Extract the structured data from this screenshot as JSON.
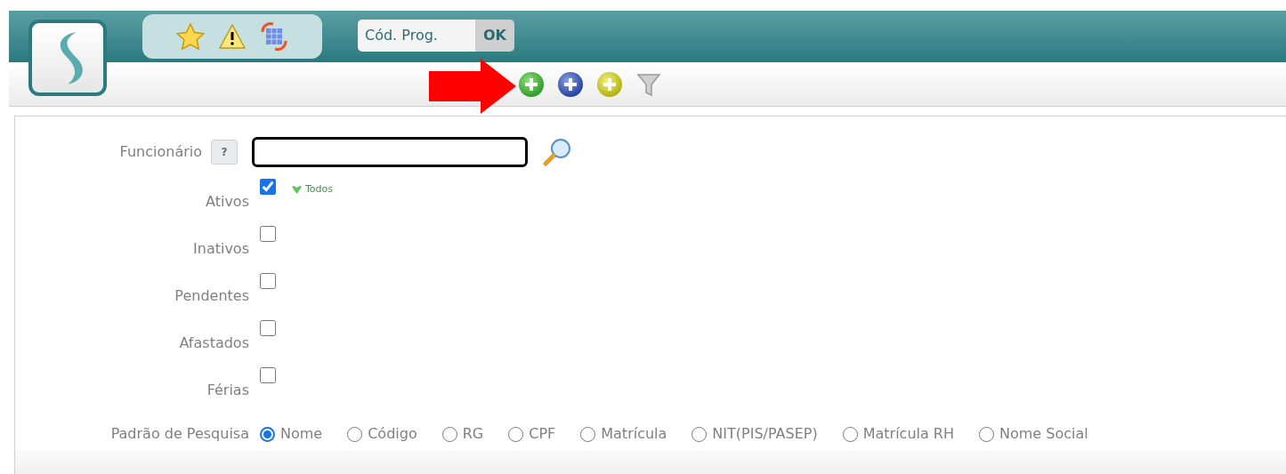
{
  "header": {
    "code_field": {
      "placeholder": "Cód. Prog."
    },
    "ok_button": "OK"
  },
  "form": {
    "employee": {
      "label": "Funcionário",
      "help": "?"
    },
    "statuses": [
      {
        "label": "Ativos",
        "checked": true,
        "link": "Todos"
      },
      {
        "label": "Inativos",
        "checked": false
      },
      {
        "label": "Pendentes",
        "checked": false
      },
      {
        "label": "Afastados",
        "checked": false
      },
      {
        "label": "Férias",
        "checked": false
      }
    ],
    "search_pattern": {
      "label": "Padrão de Pesquisa",
      "options": [
        {
          "label": "Nome",
          "selected": true
        },
        {
          "label": "Código",
          "selected": false
        },
        {
          "label": "RG",
          "selected": false
        },
        {
          "label": "CPF",
          "selected": false
        },
        {
          "label": "Matrícula",
          "selected": false
        },
        {
          "label": "NIT(PIS/PASEP)",
          "selected": false
        },
        {
          "label": "Matrícula RH",
          "selected": false
        },
        {
          "label": "Nome Social",
          "selected": false
        }
      ]
    }
  }
}
